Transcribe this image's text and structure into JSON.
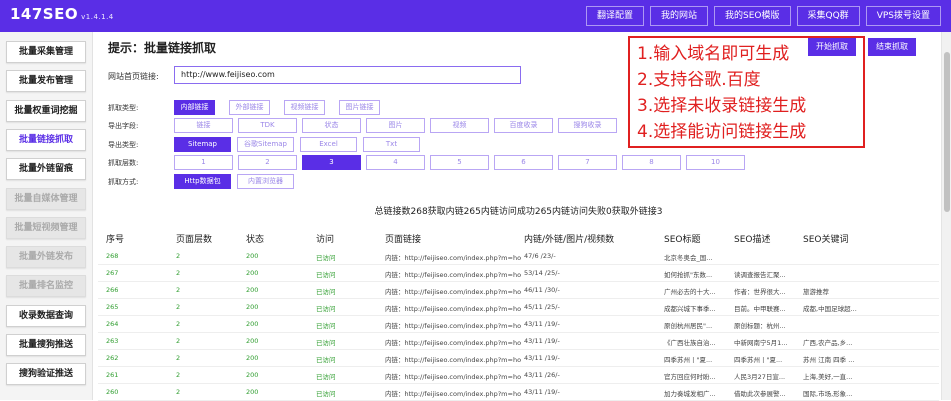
{
  "app": {
    "name": "147SEO",
    "version": "v1.4.1.4"
  },
  "topnav": [
    "翻译配置",
    "我的网站",
    "我的SEO模版",
    "采集QQ群",
    "VPS拨号设置"
  ],
  "sidebar": [
    {
      "label": "批量采集管理",
      "state": "normal"
    },
    {
      "label": "批量发布管理",
      "state": "normal"
    },
    {
      "label": "批量权重词挖掘",
      "state": "normal"
    },
    {
      "label": "批量链接抓取",
      "state": "active"
    },
    {
      "label": "批量外链留痕",
      "state": "normal"
    },
    {
      "label": "批量自媒体管理",
      "state": "disabled"
    },
    {
      "label": "批量短视频管理",
      "state": "disabled"
    },
    {
      "label": "批量外链发布",
      "state": "disabled"
    },
    {
      "label": "批量排名监控",
      "state": "disabled"
    },
    {
      "label": "收录数据查询",
      "state": "normal"
    },
    {
      "label": "批量搜狗推送",
      "state": "normal"
    },
    {
      "label": "搜狗验证推送",
      "state": "normal"
    }
  ],
  "page": {
    "title": "提示：批量链接抓取",
    "start_button": "开始抓取",
    "stop_button": "结束抓取",
    "url_label": "网站首页链接:",
    "url_value": "http://www.feijiseo.com"
  },
  "options": {
    "crawl_type": {
      "label": "抓取类型:",
      "items": [
        "内部链接",
        "外部链接",
        "视频链接",
        "图片链接"
      ],
      "selected": 0
    },
    "export_fields": {
      "label": "导出字段:",
      "items": [
        "链接",
        "TDK",
        "状态",
        "图片",
        "视频",
        "百度收录",
        "搜狗收录"
      ],
      "selected": -1
    },
    "export_type": {
      "label": "导出类型:",
      "items": [
        "Sitemap",
        "谷歌Sitemap",
        "Excel",
        "Txt"
      ],
      "selected": 0
    },
    "crawl_depth": {
      "label": "抓取层数:",
      "items": [
        "1",
        "2",
        "3",
        "4",
        "5",
        "6",
        "7",
        "8",
        "10"
      ],
      "selected": 2
    },
    "crawl_method": {
      "label": "抓取方式:",
      "items": [
        "Http数据包",
        "内置浏览器"
      ],
      "selected": 0
    }
  },
  "annotation": [
    "1.输入域名即可生成",
    "2.支持谷歌.百度",
    "3.选择未收录链接生成",
    "4.选择能访问链接生成"
  ],
  "summary": "总链接数268获取内链265内链访问成功265内链访问失败0获取外链接3",
  "table": {
    "headers": [
      "序号",
      "页面层数",
      "状态",
      "访问",
      "页面链接",
      "内链/外链/图片/视频数",
      "SEO标题",
      "SEO描述",
      "SEO关键词"
    ],
    "rows": [
      [
        "268",
        "2",
        "200",
        "已访问",
        "内链：http://feijiseo.com/index.php?m=hon",
        "47/6 /23/-",
        "北京冬奥会_国...",
        "",
        ""
      ],
      [
        "267",
        "2",
        "200",
        "已访问",
        "内链：http://feijiseo.com/index.php?m=hon",
        "53/14 /25/-",
        "如何抢抓\"东数...",
        "读调查报告汇聚...",
        ""
      ],
      [
        "266",
        "2",
        "200",
        "已访问",
        "内链：http://feijiseo.com/index.php?m=hon",
        "46/11 /30/-",
        "广州必去的十大...",
        "作者：世界很大...",
        "旅游推荐"
      ],
      [
        "265",
        "2",
        "200",
        "已访问",
        "内链：http://feijiseo.com/index.php?m=hon",
        "45/11 /25/-",
        "成都兴城下事季...",
        "目前。中甲联赛...",
        "成都,中国足球超..."
      ],
      [
        "264",
        "2",
        "200",
        "已访问",
        "内链：http://feijiseo.com/index.php?m=hon",
        "43/11 /19/-",
        "原创杭州居民\"...",
        "原创标题：杭州...",
        ""
      ],
      [
        "263",
        "2",
        "200",
        "已访问",
        "内链：http://feijiseo.com/index.php?m=hon",
        "43/11 /19/-",
        "《广西壮族自治...",
        "中新网南宁5月1...",
        "广西,农产品,乡..."
      ],
      [
        "262",
        "2",
        "200",
        "已访问",
        "内链：http://feijiseo.com/index.php?m=hon",
        "43/11 /19/-",
        "四季苏州丨\"夏...",
        "四季苏州丨\"夏...",
        "苏州 江南 四季 ..."
      ],
      [
        "261",
        "2",
        "200",
        "已访问",
        "内链：http://feijiseo.com/index.php?m=hon",
        "43/11 /26/-",
        "官方回应何时盼...",
        "人民3月27日宣...",
        "上海,美好,一直..."
      ],
      [
        "260",
        "2",
        "200",
        "已访问",
        "内链：http://feijiseo.com/index.php?m=hon",
        "43/11 /19/-",
        "加力奏城发相广...",
        "借助此次参展警...",
        "国际,市场,形象..."
      ]
    ]
  }
}
